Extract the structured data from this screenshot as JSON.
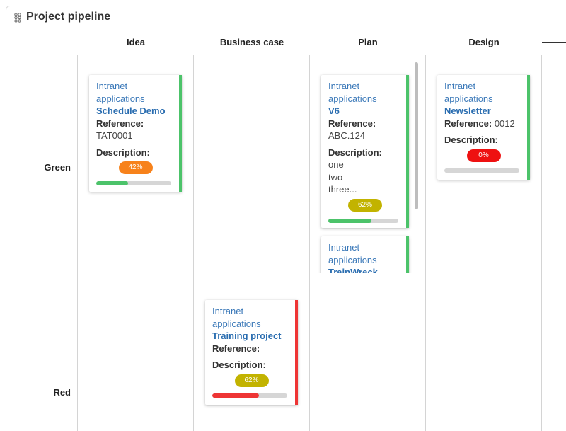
{
  "widget": {
    "title": "Project pipeline",
    "icon": "drag-handle-icon"
  },
  "columns": [
    "Idea",
    "Business case",
    "Plan",
    "Design"
  ],
  "rows": [
    "Green",
    "Red"
  ],
  "colors": {
    "green": "#4cc36a",
    "red": "#ee3535",
    "orange": "#f7821b",
    "olive": "#c2b300",
    "badge_red": "#ee1111",
    "fill_green": "#4cc36a",
    "fill_red": "#ee3535"
  },
  "labels": {
    "reference": "Reference:",
    "description": "Description:"
  },
  "cards": [
    {
      "category": "Intranet applications",
      "name": "Schedule Demo",
      "reference": "TAT0001",
      "description": [],
      "percent_label": "42%",
      "progress": 0.42
    },
    {
      "category": "Intranet applications",
      "name": "V6",
      "reference": "ABC.124",
      "description": [
        "one",
        "two",
        "three..."
      ],
      "percent_label": "62%",
      "progress": 0.62
    },
    {
      "category": "Intranet applications",
      "name": "TrainWreck"
    },
    {
      "category": "Intranet applications",
      "name": "Newsletter",
      "reference": "0012",
      "description": [],
      "percent_label": "0%",
      "progress": 0
    },
    {
      "category": "Intranet applications",
      "name": "Training project",
      "reference": "",
      "description": [],
      "percent_label": "62%",
      "progress": 0.62
    }
  ]
}
